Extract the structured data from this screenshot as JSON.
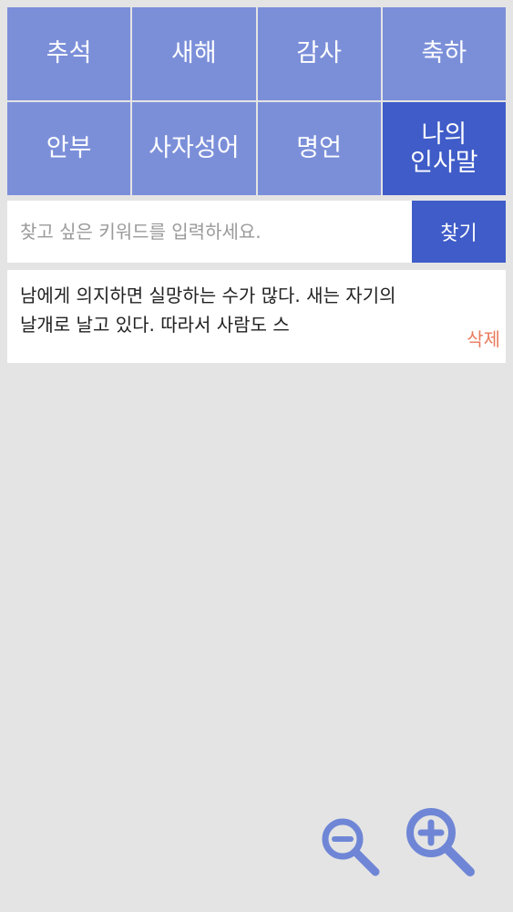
{
  "categories": [
    {
      "label": "추석",
      "active": false
    },
    {
      "label": "새해",
      "active": false
    },
    {
      "label": "감사",
      "active": false
    },
    {
      "label": "축하",
      "active": false
    },
    {
      "label": "안부",
      "active": false
    },
    {
      "label": "사자성어",
      "active": false
    },
    {
      "label": "명언",
      "active": false
    },
    {
      "label": "나의\n인사말",
      "active": true
    }
  ],
  "search": {
    "placeholder": "찾고 싶은 키워드를 입력하세요.",
    "value": "",
    "button_label": "찾기"
  },
  "card": {
    "text": "남에게 의지하면 실망하는 수가 많다. 새는 자기의 날개로 날고 있다. 따라서 사람도 스",
    "delete_label": "삭제"
  },
  "colors": {
    "category": "#7b8fd9",
    "category_active": "#3f5cc8",
    "search_button": "#3f5cc8",
    "delete": "#e87a5d",
    "zoom_icon": "#6f86d6"
  },
  "icons": {
    "zoom_out": "zoom-out-icon",
    "zoom_in": "zoom-in-icon"
  }
}
